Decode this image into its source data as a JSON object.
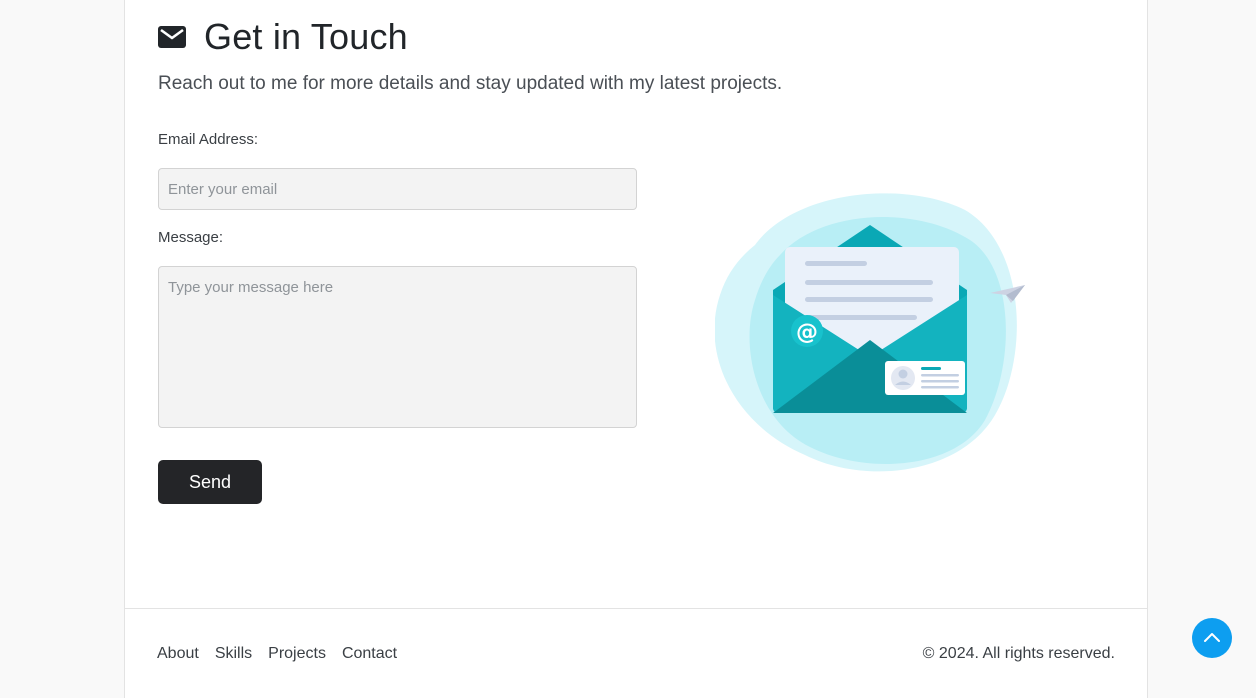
{
  "contact": {
    "title": "Get in Touch",
    "title_icon": "envelope-icon",
    "subtitle": "Reach out to me for more details and stay updated with my latest projects.",
    "email_label": "Email Address:",
    "email_placeholder": "Enter your email",
    "email_value": "",
    "message_label": "Message:",
    "message_placeholder": "Type your message here",
    "message_value": "",
    "send_label": "Send",
    "illustration_icon": "open-envelope-illustration"
  },
  "footer": {
    "links": [
      "About",
      "Skills",
      "Projects",
      "Contact"
    ],
    "copyright": "© 2024. All rights reserved."
  },
  "scroll_top": {
    "icon": "chevron-up-icon"
  },
  "colors": {
    "accent": "#0d9ef0",
    "button_dark": "#242528",
    "illustration_teal": "#0aa8b5",
    "illustration_light": "#b8eef5"
  }
}
